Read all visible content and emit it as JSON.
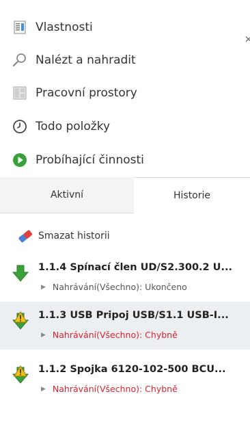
{
  "menu": {
    "items": [
      {
        "label": "Vlastnosti",
        "icon": "properties-icon"
      },
      {
        "label": "Nalézt a nahradit",
        "icon": "search-icon"
      },
      {
        "label": "Pracovní prostory",
        "icon": "workspaces-icon"
      },
      {
        "label": "Todo položky",
        "icon": "clock-icon"
      },
      {
        "label": "Probíhající činnosti",
        "icon": "play-icon"
      }
    ]
  },
  "tabs": {
    "active_label": "Aktivní",
    "history_label": "Historie"
  },
  "history": {
    "clear_label": "Smazat historii",
    "items": [
      {
        "title": "1.1.4 Spínací člen UD/S2.300.2 U...",
        "status": "Nahrávání(Všechno): Ukončeno",
        "state": "ok",
        "icon": "download-arrow-icon"
      },
      {
        "title": "1.1.3 USB Pripoj USB/S1.1 USB-I...",
        "status": "Nahrávání(Všechno): Chybně",
        "state": "error",
        "icon": "download-warning-icon"
      },
      {
        "title": "1.1.2 Spojka 6120-102-500 BCU...",
        "status": "Nahrávání(Všechno): Chybně",
        "state": "error",
        "icon": "download-warning-icon"
      }
    ]
  },
  "colors": {
    "error": "#d9232e",
    "arrow_green": "#3aa13a",
    "warning_yellow": "#f2c21b",
    "selected_row": "#eceff2"
  }
}
